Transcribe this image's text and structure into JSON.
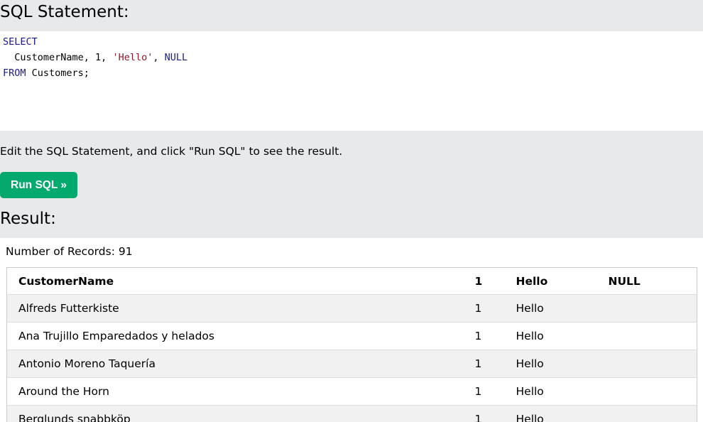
{
  "sql_section": {
    "heading": "SQL Statement:",
    "code_lines": [
      [
        {
          "t": "SELECT",
          "c": "kw"
        }
      ],
      [
        {
          "t": "  CustomerName, 1, ",
          "c": ""
        },
        {
          "t": "'Hello'",
          "c": "str"
        },
        {
          "t": ", ",
          "c": ""
        },
        {
          "t": "NULL",
          "c": "nul"
        }
      ],
      [
        {
          "t": "FROM",
          "c": "kw"
        },
        {
          "t": " Customers;",
          "c": ""
        }
      ]
    ]
  },
  "hint": "Edit the SQL Statement, and click \"Run SQL\" to see the result.",
  "run_button": {
    "label": "Run SQL »"
  },
  "result_section": {
    "heading": "Result:",
    "record_count": "Number of Records: 91",
    "columns": [
      "CustomerName",
      "1",
      "Hello",
      "NULL"
    ],
    "rows": [
      [
        "Alfreds Futterkiste",
        "1",
        "Hello",
        ""
      ],
      [
        "Ana Trujillo Emparedados y helados",
        "1",
        "Hello",
        ""
      ],
      [
        "Antonio Moreno Taquería",
        "1",
        "Hello",
        ""
      ],
      [
        "Around the Horn",
        "1",
        "Hello",
        ""
      ],
      [
        "Berglunds snabbköp",
        "1",
        "Hello",
        ""
      ]
    ]
  }
}
